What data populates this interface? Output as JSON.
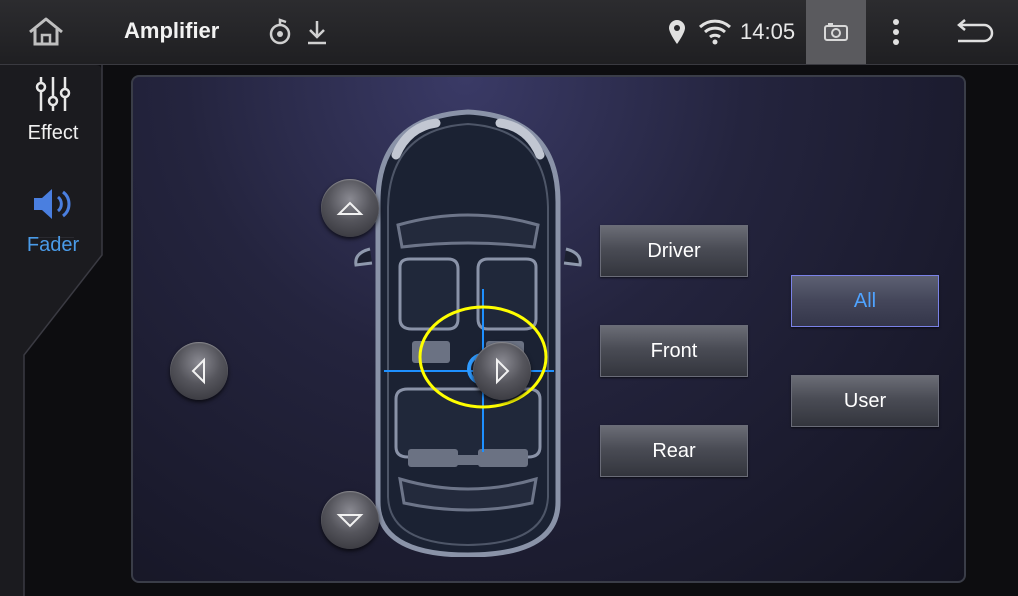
{
  "statusbar": {
    "title": "Amplifier",
    "time": "14:05",
    "icons": [
      "home-icon",
      "music-sync-icon",
      "download-icon",
      "location-icon",
      "wifi-icon",
      "screenshot-icon",
      "more-icon",
      "back-icon"
    ]
  },
  "sidebar": {
    "items": [
      {
        "label": "Effect",
        "icon": "equalizer-icon",
        "active": false
      },
      {
        "label": "Fader",
        "icon": "speaker-icon",
        "active": true
      }
    ]
  },
  "fader": {
    "zone_buttons": {
      "driver": "Driver",
      "front": "Front",
      "rear": "Rear"
    },
    "mode_buttons": {
      "all": "All",
      "user": "User"
    },
    "selected_mode": "All",
    "colors": {
      "accent": "#4fa3ff",
      "crosshair": "#1e90ff",
      "highlight_ring": "#ffff00"
    }
  }
}
